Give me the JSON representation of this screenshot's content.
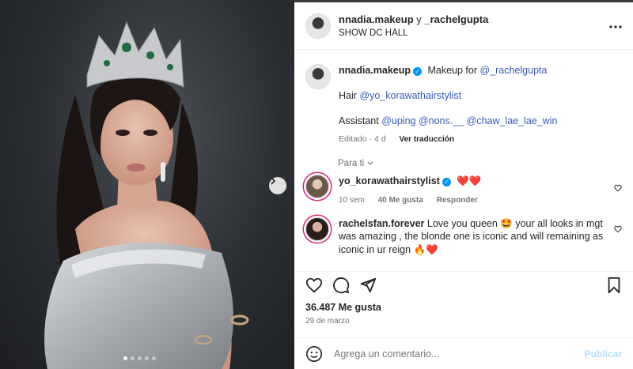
{
  "post": {
    "header": {
      "user1": "nnadia.makeup",
      "joiner": "y",
      "user2": "_rachelgupta",
      "location": "SHOW DC HALL"
    },
    "caption": {
      "username": "nnadia.makeup",
      "text": "Makeup for",
      "mention1": "@_rachelgupta",
      "hair_label": "Hair",
      "hair_mention": "@yo_korawathairstylist",
      "assistant_label": "Assistant",
      "assistant_mentions": "@uping @nons.__ @chaw_lae_lae_win",
      "edited": "Editado · 4 d",
      "translate": "Ver traducción"
    },
    "for_you": "Para ti",
    "comments": [
      {
        "username": "yo_korawathairstylist",
        "text": "❤️❤️",
        "time": "10 sem",
        "likes": "40 Me gusta",
        "reply": "Responder"
      },
      {
        "username": "rachelsfan.forever",
        "text": "Love you queen 🤩 your all looks in mgt was amazing , the blonde one is iconic and will remaining as iconic in ur reign 🔥❤️"
      }
    ],
    "likes": "36.487 Me gusta",
    "date": "29 de marzo",
    "comment_placeholder": "Agrega un comentario...",
    "publish": "Publicar"
  },
  "icons": {
    "more": "more-options-icon",
    "like": "heart-icon",
    "comment": "comment-icon",
    "share": "share-icon",
    "save": "bookmark-icon",
    "emoji": "emoji-icon",
    "next": "chevron-right-icon"
  },
  "colors": {
    "link": "#385ab5",
    "publish": "#b2dffc",
    "verified": "#0095f6"
  }
}
